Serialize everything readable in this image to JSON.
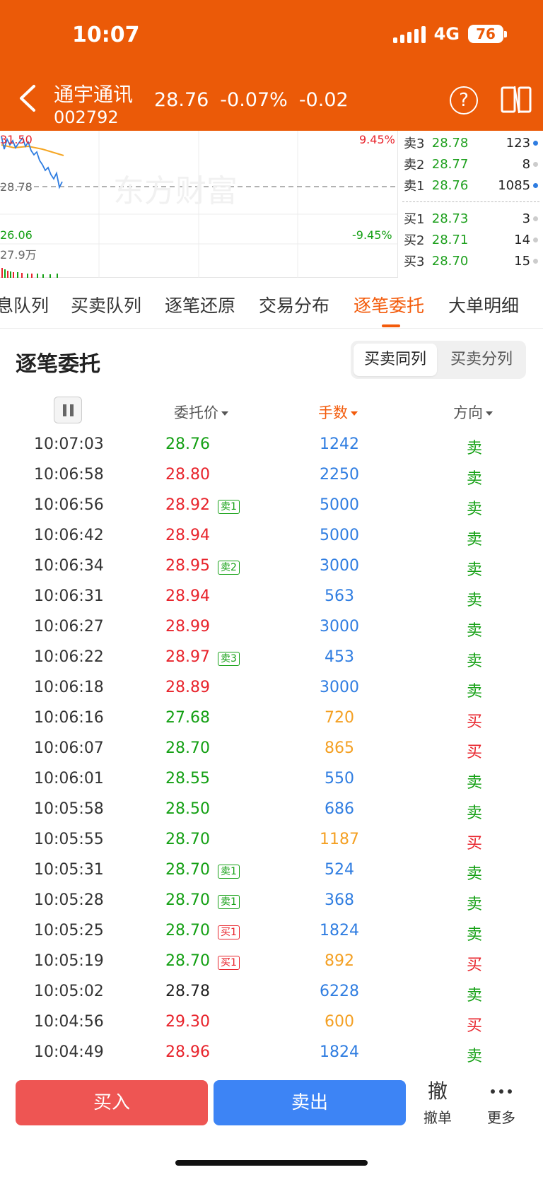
{
  "status_bar": {
    "time": "10:07",
    "network": "4G",
    "battery": "76"
  },
  "stock": {
    "name": "通宇通讯",
    "code": "002792",
    "price": "28.76",
    "change_pct": "-0.07%",
    "change": "-0.02"
  },
  "icons": {
    "back": "back-arrow-icon",
    "help": "help-icon",
    "switch": "switch-view-icon",
    "pause": "pause-icon",
    "more": "more-icon"
  },
  "mini_chart": {
    "high_price": "31.50",
    "ref_price": "28.78",
    "low_price": "26.06",
    "high_pct": "9.45%",
    "low_pct": "-9.45%",
    "volume": "27.9万",
    "watermark": "东方财富"
  },
  "order_book": {
    "asks": [
      {
        "label": "卖3",
        "price": "28.78",
        "volume": "123",
        "dot": "#2f7de1"
      },
      {
        "label": "卖2",
        "price": "28.77",
        "volume": "8",
        "dot": "#cccccc"
      },
      {
        "label": "卖1",
        "price": "28.76",
        "volume": "1085",
        "dot": "#2f7de1"
      }
    ],
    "bids": [
      {
        "label": "买1",
        "price": "28.73",
        "volume": "3",
        "dot": "#cccccc"
      },
      {
        "label": "买2",
        "price": "28.71",
        "volume": "14",
        "dot": "#cccccc"
      },
      {
        "label": "买3",
        "price": "28.70",
        "volume": "15",
        "dot": "#cccccc"
      }
    ]
  },
  "tabs": [
    "息队列",
    "买卖队列",
    "逐笔还原",
    "交易分布",
    "逐笔委托",
    "大单明细"
  ],
  "active_tab": "逐笔委托",
  "section": {
    "title": "逐笔委托",
    "toggle_on": "买卖同列",
    "toggle_off": "买卖分列"
  },
  "columns": {
    "price": "委托价",
    "volume": "手数",
    "direction": "方向"
  },
  "colors": {
    "red": "#e8232b",
    "green": "#14a014",
    "blue": "#2f7de1",
    "orange": "#f4a023",
    "black": "#222222",
    "accent": "#eb5a08"
  },
  "rows": [
    {
      "time": "10:07:03",
      "price": "28.76",
      "pc": "green",
      "tag": "",
      "tc": "",
      "vol": "1242",
      "vc": "blue",
      "dir": "卖",
      "dc": "green"
    },
    {
      "time": "10:06:58",
      "price": "28.80",
      "pc": "red",
      "tag": "",
      "tc": "",
      "vol": "2250",
      "vc": "blue",
      "dir": "卖",
      "dc": "green"
    },
    {
      "time": "10:06:56",
      "price": "28.92",
      "pc": "red",
      "tag": "卖1",
      "tc": "green",
      "vol": "5000",
      "vc": "blue",
      "dir": "卖",
      "dc": "green"
    },
    {
      "time": "10:06:42",
      "price": "28.94",
      "pc": "red",
      "tag": "",
      "tc": "",
      "vol": "5000",
      "vc": "blue",
      "dir": "卖",
      "dc": "green"
    },
    {
      "time": "10:06:34",
      "price": "28.95",
      "pc": "red",
      "tag": "卖2",
      "tc": "green",
      "vol": "3000",
      "vc": "blue",
      "dir": "卖",
      "dc": "green"
    },
    {
      "time": "10:06:31",
      "price": "28.94",
      "pc": "red",
      "tag": "",
      "tc": "",
      "vol": "563",
      "vc": "blue",
      "dir": "卖",
      "dc": "green"
    },
    {
      "time": "10:06:27",
      "price": "28.99",
      "pc": "red",
      "tag": "",
      "tc": "",
      "vol": "3000",
      "vc": "blue",
      "dir": "卖",
      "dc": "green"
    },
    {
      "time": "10:06:22",
      "price": "28.97",
      "pc": "red",
      "tag": "卖3",
      "tc": "green",
      "vol": "453",
      "vc": "blue",
      "dir": "卖",
      "dc": "green"
    },
    {
      "time": "10:06:18",
      "price": "28.89",
      "pc": "red",
      "tag": "",
      "tc": "",
      "vol": "3000",
      "vc": "blue",
      "dir": "卖",
      "dc": "green"
    },
    {
      "time": "10:06:16",
      "price": "27.68",
      "pc": "green",
      "tag": "",
      "tc": "",
      "vol": "720",
      "vc": "orange",
      "dir": "买",
      "dc": "red"
    },
    {
      "time": "10:06:07",
      "price": "28.70",
      "pc": "green",
      "tag": "",
      "tc": "",
      "vol": "865",
      "vc": "orange",
      "dir": "买",
      "dc": "red"
    },
    {
      "time": "10:06:01",
      "price": "28.55",
      "pc": "green",
      "tag": "",
      "tc": "",
      "vol": "550",
      "vc": "blue",
      "dir": "卖",
      "dc": "green"
    },
    {
      "time": "10:05:58",
      "price": "28.50",
      "pc": "green",
      "tag": "",
      "tc": "",
      "vol": "686",
      "vc": "blue",
      "dir": "卖",
      "dc": "green"
    },
    {
      "time": "10:05:55",
      "price": "28.70",
      "pc": "green",
      "tag": "",
      "tc": "",
      "vol": "1187",
      "vc": "orange",
      "dir": "买",
      "dc": "red"
    },
    {
      "time": "10:05:31",
      "price": "28.70",
      "pc": "green",
      "tag": "卖1",
      "tc": "green",
      "vol": "524",
      "vc": "blue",
      "dir": "卖",
      "dc": "green"
    },
    {
      "time": "10:05:28",
      "price": "28.70",
      "pc": "green",
      "tag": "卖1",
      "tc": "green",
      "vol": "368",
      "vc": "blue",
      "dir": "卖",
      "dc": "green"
    },
    {
      "time": "10:05:25",
      "price": "28.70",
      "pc": "green",
      "tag": "买1",
      "tc": "red",
      "vol": "1824",
      "vc": "blue",
      "dir": "卖",
      "dc": "green"
    },
    {
      "time": "10:05:19",
      "price": "28.70",
      "pc": "green",
      "tag": "买1",
      "tc": "red",
      "vol": "892",
      "vc": "orange",
      "dir": "买",
      "dc": "red"
    },
    {
      "time": "10:05:02",
      "price": "28.78",
      "pc": "black",
      "tag": "",
      "tc": "",
      "vol": "6228",
      "vc": "blue",
      "dir": "卖",
      "dc": "green"
    },
    {
      "time": "10:04:56",
      "price": "29.30",
      "pc": "red",
      "tag": "",
      "tc": "",
      "vol": "600",
      "vc": "orange",
      "dir": "买",
      "dc": "red"
    },
    {
      "time": "10:04:49",
      "price": "28.96",
      "pc": "red",
      "tag": "",
      "tc": "",
      "vol": "1824",
      "vc": "blue",
      "dir": "卖",
      "dc": "green"
    }
  ],
  "bottom": {
    "buy": "买入",
    "sell": "卖出",
    "cancel_icon": "撤",
    "cancel": "撤单",
    "more": "更多"
  }
}
